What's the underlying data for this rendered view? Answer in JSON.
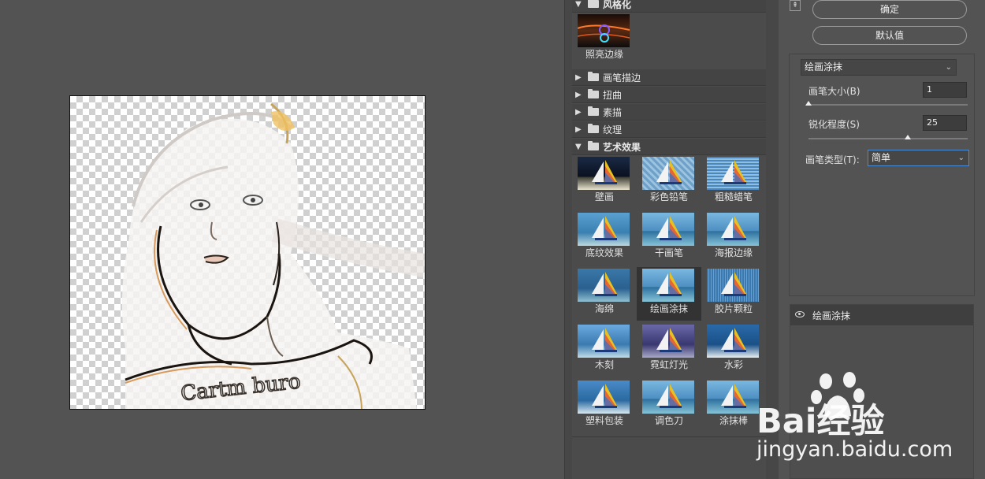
{
  "gallery": {
    "stylize": {
      "label": "风格化",
      "thumbs": [
        {
          "label": "照亮边缘"
        }
      ]
    },
    "collapsed": [
      {
        "label": "画笔描边"
      },
      {
        "label": "扭曲"
      },
      {
        "label": "素描"
      },
      {
        "label": "纹理"
      }
    ],
    "artistic": {
      "label": "艺术效果",
      "thumbs": [
        {
          "label": "壁画"
        },
        {
          "label": "彩色铅笔"
        },
        {
          "label": "粗糙蜡笔"
        },
        {
          "label": "底纹效果"
        },
        {
          "label": "干画笔"
        },
        {
          "label": "海报边缘"
        },
        {
          "label": "海绵"
        },
        {
          "label": "绘画涂抹"
        },
        {
          "label": "胶片颗粒"
        },
        {
          "label": "木刻"
        },
        {
          "label": "霓虹灯光"
        },
        {
          "label": "水彩"
        },
        {
          "label": "塑料包装"
        },
        {
          "label": "调色刀"
        },
        {
          "label": "涂抹棒"
        }
      ],
      "selected": "绘画涂抹"
    }
  },
  "panel": {
    "ok_label": "确定",
    "default_label": "默认值",
    "filter_select": "绘画涂抹",
    "brush_size": {
      "label": "画笔大小(B)",
      "value": "1",
      "fraction": 0.0
    },
    "sharpness": {
      "label": "锐化程度(S)",
      "value": "25",
      "fraction": 0.625
    },
    "brush_type": {
      "label": "画笔类型(T):",
      "value": "简单"
    },
    "layer": {
      "name": "绘画涂抹"
    }
  },
  "watermark": {
    "brand": "Bai经验",
    "url": "jingyan.baidu.com"
  },
  "colors": {
    "bg": "#535353",
    "panel_dark": "#444444",
    "accent_focus": "#4a8bd6"
  }
}
